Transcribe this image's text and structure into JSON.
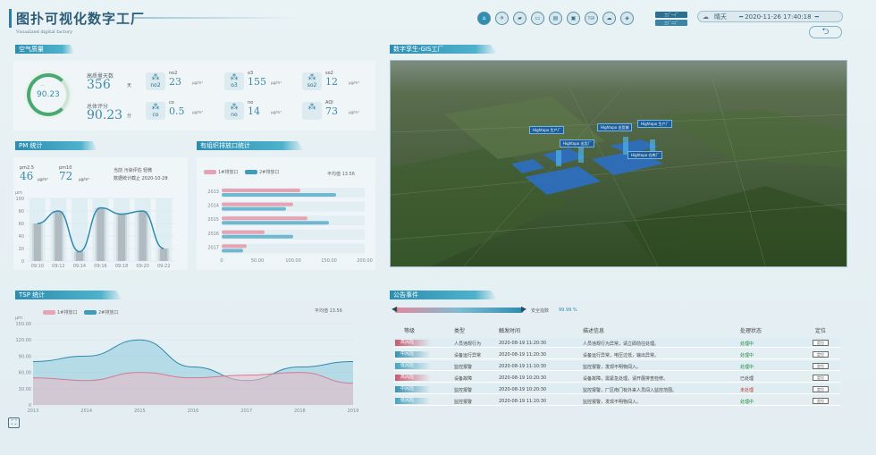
{
  "header": {
    "title": "图扑可视化数字工厂",
    "subtitle": "Visualized digital factory",
    "nav_icons": [
      "home-icon",
      "plane-icon",
      "truck-icon",
      "camera-icon",
      "bus-icon",
      "monitor-icon",
      "tsp-label-icon",
      "cloud-icon",
      "layers-icon"
    ],
    "tsp_text": "TSP",
    "factory_btn_1": "工厂一厂",
    "factory_btn_2": "工厂二厂",
    "weather": "晴天",
    "datetime": "2020-11-26 17:40:18",
    "back_label": "返回"
  },
  "air_quality": {
    "section_title": "空气质量",
    "ring_label": "...",
    "ring_value": "90.23",
    "excellent_days_label": "高质量天数",
    "excellent_days_value": "356",
    "excellent_days_unit": "天",
    "score_label": "总体评分",
    "score_value": "90.23",
    "score_unit": "分",
    "metrics": [
      {
        "icon_label": "no2",
        "name": "no2",
        "value": "23",
        "unit": "μg/m³"
      },
      {
        "icon_label": "o3",
        "name": "o3",
        "value": "155",
        "unit": "μg/m³"
      },
      {
        "icon_label": "so2",
        "name": "so2",
        "value": "12",
        "unit": "μg/m³"
      },
      {
        "icon_label": "co",
        "name": "co",
        "value": "0.5",
        "unit": "μg/m³"
      },
      {
        "icon_label": "no",
        "name": "no",
        "value": "14",
        "unit": "μg/m³"
      },
      {
        "icon_label": "",
        "name": "AQI",
        "value": "73",
        "unit": "μg/m³"
      }
    ]
  },
  "pm": {
    "section_title": "PM 统计",
    "pm25_label": "pm2.5",
    "pm25_value": "46",
    "pm10_label": "pm10",
    "pm10_value": "72",
    "unit": "μg/m³",
    "eval_text": "当前 污染评估 轻微",
    "date_text": "数据统计截止 2020-10-28",
    "y_unit": "μm"
  },
  "outlet": {
    "section_title": "有组织排放口统计",
    "legend_1": "1#排放口",
    "legend_2": "2#排放口",
    "avg_label": "平均值",
    "avg_value": "13.56"
  },
  "twin": {
    "section_title": "数字孪生-GIS工厂",
    "tags": [
      "Hightopo 生产厂",
      "Hightopo 出货城",
      "Hightopo 生产厂",
      "Hightopo 出货厂",
      "Hightopo 仓库厂"
    ]
  },
  "tsp": {
    "section_title": "TSP 统计",
    "legend_1": "1#排放口",
    "legend_2": "2#排放口",
    "avg_label": "平均值",
    "avg_value": "13.56",
    "y_unit": "μm"
  },
  "events": {
    "section_title": "公告事件",
    "safety_label": "安全指数",
    "safety_value": "99.99 %",
    "columns": [
      "等级",
      "类型",
      "触发时间",
      "描述信息",
      "处理状态",
      "定位"
    ],
    "rows": [
      {
        "level": "高风险",
        "level_class": "high",
        "type": "人员违规行为",
        "time": "2020-08-19 11:20:30",
        "desc": "人员违规行为异常，请立即前往处理。",
        "status": "处理中",
        "status_class": "processing",
        "loc": "定位"
      },
      {
        "level": "中风险",
        "level_class": "mid",
        "type": "设备运行异常",
        "time": "2020-08-19 11:20:30",
        "desc": "设备运行异常，电压过低，输出异常。",
        "status": "处理中",
        "status_class": "processing",
        "loc": "定位"
      },
      {
        "level": "低风险",
        "level_class": "low",
        "type": "监控报警",
        "time": "2020-08-19 11:10:30",
        "desc": "监控报警，发现不明物闯入。",
        "status": "处理中",
        "status_class": "processing",
        "loc": "定位"
      },
      {
        "level": "高风险",
        "level_class": "high",
        "type": "设备故障",
        "time": "2020-08-19 10:20:30",
        "desc": "设备故障，需紧急处理，请开展排查检修。",
        "status": "已处理",
        "status_class": "done",
        "loc": "定位"
      },
      {
        "level": "中风险",
        "level_class": "mid",
        "type": "监控报警",
        "time": "2020-08-19 10:20:30",
        "desc": "监控报警，厂区南门有外来人员闯入监控范围。",
        "status": "未处理",
        "status_class": "pending",
        "loc": "定位"
      },
      {
        "level": "低风险",
        "level_class": "low",
        "type": "监控报警",
        "time": "2020-08-19 11:10:30",
        "desc": "监控报警，发现不明物闯入。",
        "status": "处理中",
        "status_class": "processing",
        "loc": "定位"
      }
    ]
  },
  "chart_data": [
    {
      "type": "bar",
      "categories": [
        "09:10",
        "09:12",
        "09:14",
        "09:16",
        "09:18",
        "09:20",
        "09:22"
      ],
      "series": [
        {
          "values": [
            60,
            80,
            15,
            85,
            75,
            80,
            20
          ]
        }
      ],
      "xlabel": "",
      "ylabel": "μm",
      "ylim": [
        0,
        100
      ],
      "y_ticks": [
        "0",
        "20",
        "40",
        "60",
        "80",
        "100"
      ]
    },
    {
      "type": "bar",
      "categories": [
        "2013",
        "2014",
        "2015",
        "2016",
        "2017"
      ],
      "series": [
        {
          "name": "1#排放口",
          "values": [
            110,
            100,
            120,
            60,
            35
          ]
        },
        {
          "name": "2#排放口",
          "values": [
            160,
            90,
            150,
            100,
            30
          ]
        }
      ],
      "x_ticks": [
        "0",
        "50.00",
        "100.00",
        "150.00",
        "200.00"
      ],
      "xlim": [
        0,
        200
      ]
    },
    {
      "type": "area",
      "categories": [
        "2013",
        "2014",
        "2015",
        "2016",
        "2017",
        "2018",
        "2019"
      ],
      "series": [
        {
          "name": "1#排放口",
          "values": [
            50,
            45,
            60,
            50,
            55,
            60,
            40
          ]
        },
        {
          "name": "2#排放口",
          "values": [
            80,
            90,
            120,
            70,
            45,
            70,
            80
          ]
        }
      ],
      "ylabel": "μm",
      "ylim": [
        0,
        150
      ],
      "y_ticks": [
        "0",
        "30.00",
        "60.00",
        "90.00",
        "120.00",
        "150.00"
      ]
    }
  ]
}
